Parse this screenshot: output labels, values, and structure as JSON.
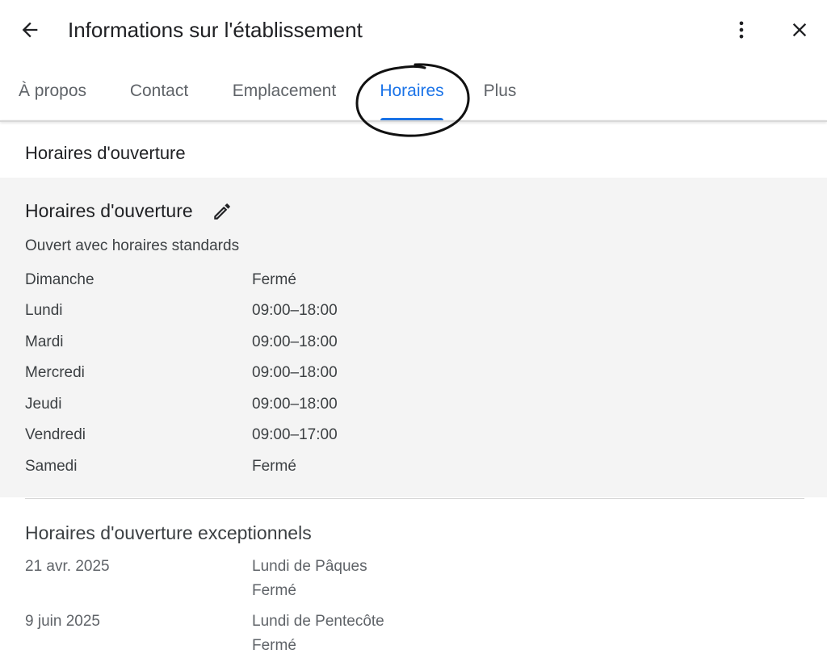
{
  "header": {
    "title": "Informations sur l'établissement",
    "back_icon": "arrow-left-icon",
    "more_icon": "more-vert-icon",
    "close_icon": "close-icon"
  },
  "tabs": [
    {
      "label": "À propos",
      "active": false
    },
    {
      "label": "Contact",
      "active": false
    },
    {
      "label": "Emplacement",
      "active": false
    },
    {
      "label": "Horaires",
      "active": true
    },
    {
      "label": "Plus",
      "active": false
    }
  ],
  "main": {
    "section_heading": "Horaires d'ouverture",
    "hours": {
      "title": "Horaires d'ouverture",
      "edit_icon": "pencil-icon",
      "status": "Ouvert avec horaires standards",
      "rows": [
        {
          "day": "Dimanche",
          "time": "Fermé"
        },
        {
          "day": "Lundi",
          "time": "09:00–18:00"
        },
        {
          "day": "Mardi",
          "time": "09:00–18:00"
        },
        {
          "day": "Mercredi",
          "time": "09:00–18:00"
        },
        {
          "day": "Jeudi",
          "time": "09:00–18:00"
        },
        {
          "day": "Vendredi",
          "time": "09:00–17:00"
        },
        {
          "day": "Samedi",
          "time": "Fermé"
        }
      ]
    },
    "exceptional": {
      "title": "Horaires d'ouverture exceptionnels",
      "rows": [
        {
          "date": "21 avr. 2025",
          "holiday": "Lundi de Pâques",
          "status": "Fermé"
        },
        {
          "date": "9 juin 2025",
          "holiday": "Lundi de Pentecôte",
          "status": "Fermé"
        }
      ]
    }
  },
  "colors": {
    "accent": "#1a73e8",
    "panel_background": "#f4f4f4",
    "text_primary": "#202124",
    "text_secondary": "#5f6368"
  }
}
